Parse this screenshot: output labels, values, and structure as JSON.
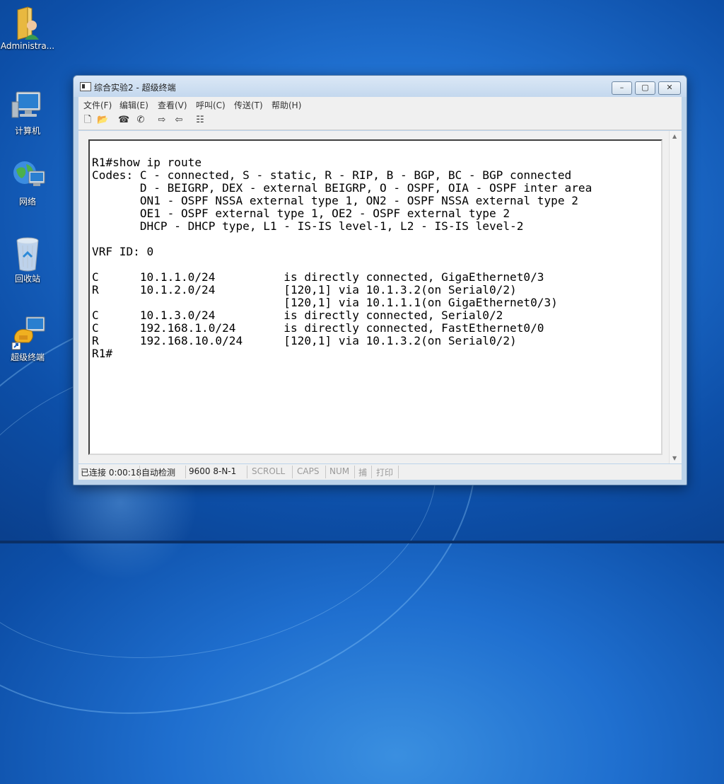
{
  "desktop": {
    "icons": [
      {
        "label": "Administra...",
        "icon": "user-folder-icon"
      },
      {
        "label": "计算机",
        "icon": "computer-icon"
      },
      {
        "label": "网络",
        "icon": "network-icon"
      },
      {
        "label": "回收站",
        "icon": "recycle-bin-icon"
      },
      {
        "label": "超级终端",
        "icon": "hyperterminal-shortcut-icon"
      }
    ]
  },
  "window": {
    "title": "综合实验2 - 超级终端",
    "controls": {
      "minimize": "–",
      "maximize": "▢",
      "close": "✕"
    },
    "menu": [
      "文件(F)",
      "编辑(E)",
      "查看(V)",
      "呼叫(C)",
      "传送(T)",
      "帮助(H)"
    ],
    "toolbar_icons": [
      "new-icon",
      "open-icon",
      "phone-icon",
      "disconnect-icon",
      "send-icon",
      "receive-icon",
      "properties-icon"
    ]
  },
  "terminal": {
    "lines": [
      "R1#show ip route",
      "Codes: C - connected, S - static, R - RIP, B - BGP, BC - BGP connected",
      "       D - BEIGRP, DEX - external BEIGRP, O - OSPF, OIA - OSPF inter area",
      "       ON1 - OSPF NSSA external type 1, ON2 - OSPF NSSA external type 2",
      "       OE1 - OSPF external type 1, OE2 - OSPF external type 2",
      "       DHCP - DHCP type, L1 - IS-IS level-1, L2 - IS-IS level-2",
      "",
      "VRF ID: 0",
      "",
      "C      10.1.1.0/24          is directly connected, GigaEthernet0/3",
      "R      10.1.2.0/24          [120,1] via 10.1.3.2(on Serial0/2)",
      "                            [120,1] via 10.1.1.1(on GigaEthernet0/3)",
      "C      10.1.3.0/24          is directly connected, Serial0/2",
      "C      192.168.1.0/24       is directly connected, FastEthernet0/0",
      "R      192.168.10.0/24      [120,1] via 10.1.3.2(on Serial0/2)",
      "R1#"
    ]
  },
  "status": {
    "connected": "已连接 0:00:18",
    "detect": "自动检测",
    "port": "9600 8-N-1",
    "scroll": "SCROLL",
    "caps": "CAPS",
    "num": "NUM",
    "capture": "捕",
    "print": "打印"
  }
}
